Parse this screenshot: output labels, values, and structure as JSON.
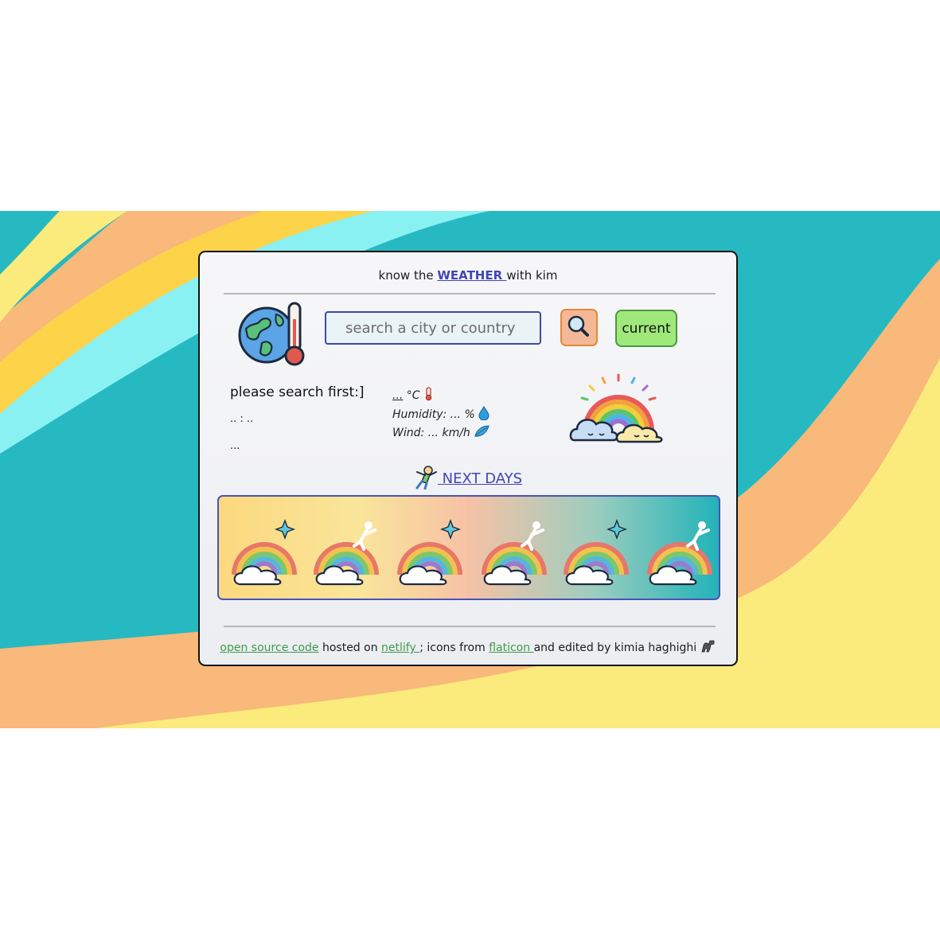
{
  "header": {
    "prefix": "know the ",
    "link": "WEATHER ",
    "suffix": "with kim"
  },
  "search": {
    "placeholder": "search a city or country",
    "value": ""
  },
  "buttons": {
    "current_label": "current"
  },
  "current": {
    "city": "please search first:]",
    "date": ".. : ..",
    "description": "...",
    "temperature_value": "...",
    "temperature_unit": " °C",
    "humidity": "Humidity: ... %",
    "wind": "Wind: ... km/h"
  },
  "next_days": {
    "label": " NEXT DAYS"
  },
  "footer": {
    "source_link": "open source code",
    "hosted_text": " hosted on ",
    "host_link": "netlify ",
    "icons_text": "; icons from ",
    "icons_link": "flaticon ",
    "credit_text": "and edited by kimia haghighi"
  },
  "colors": {
    "teal": "#27b9c1",
    "yellow": "#fbea7c",
    "orange": "#f8b97a",
    "light_blue": "#8af1f2",
    "link_blue": "#4146b3",
    "link_green": "#3f9a4c",
    "search_button": "#f5b896",
    "current_button": "#9fe87b"
  },
  "icons": {
    "globe": "globe-thermometer-icon",
    "search": "magnifier-icon",
    "rainbow": "rainbow-clouds-icon",
    "temperature": "thermometer-icon",
    "humidity": "droplet-icon",
    "wind": "wind-leaf-icon",
    "next_days": "stretching-kid-icon",
    "footer": "dinosaur-icon"
  }
}
